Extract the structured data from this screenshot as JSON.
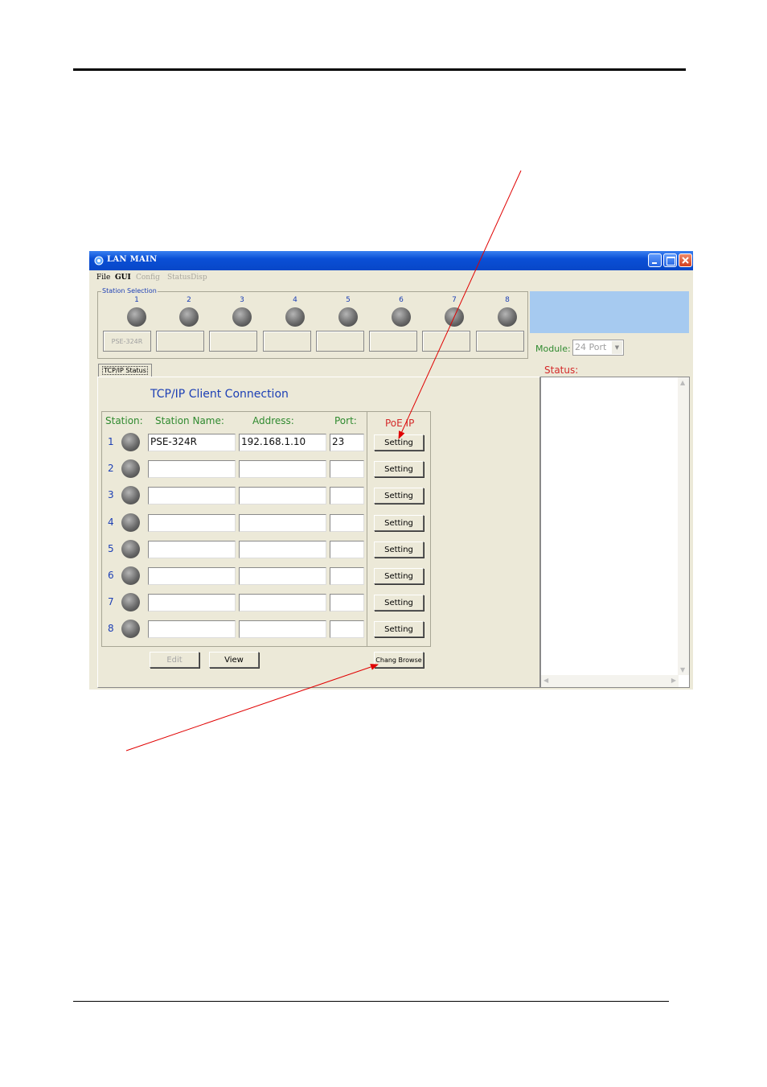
{
  "window": {
    "title": "LAN MAIN",
    "colors": {
      "titlebar": "#0a4fd6",
      "accent_blue_panel": "#a6caf0"
    }
  },
  "menu": [
    {
      "label": "File",
      "enabled": true
    },
    {
      "label": "GUI",
      "enabled": true
    },
    {
      "label": "Config",
      "enabled": false
    },
    {
      "label": "StatusDisp",
      "enabled": false
    }
  ],
  "station_selection": {
    "label": "Station Selection",
    "stations": [
      {
        "num": "1",
        "name": "PSE-324R"
      },
      {
        "num": "2",
        "name": ""
      },
      {
        "num": "3",
        "name": ""
      },
      {
        "num": "4",
        "name": ""
      },
      {
        "num": "5",
        "name": ""
      },
      {
        "num": "6",
        "name": ""
      },
      {
        "num": "7",
        "name": ""
      },
      {
        "num": "8",
        "name": ""
      }
    ]
  },
  "module": {
    "label": "Module:",
    "value": "24 Port"
  },
  "tab": {
    "label": "TCP/IP Status"
  },
  "connection": {
    "title": "TCP/IP Client Connection",
    "headers": {
      "station": "Station:",
      "name": "Station Name:",
      "address": "Address:",
      "port": "Port:",
      "poe": "PoE IP"
    },
    "setting_label": "Setting",
    "rows": [
      {
        "num": "1",
        "name": "PSE-324R",
        "address": "192.168.1.10",
        "port": "23"
      },
      {
        "num": "2",
        "name": "",
        "address": "",
        "port": ""
      },
      {
        "num": "3",
        "name": "",
        "address": "",
        "port": ""
      },
      {
        "num": "4",
        "name": "",
        "address": "",
        "port": ""
      },
      {
        "num": "5",
        "name": "",
        "address": "",
        "port": ""
      },
      {
        "num": "6",
        "name": "",
        "address": "",
        "port": ""
      },
      {
        "num": "7",
        "name": "",
        "address": "",
        "port": ""
      },
      {
        "num": "8",
        "name": "",
        "address": "",
        "port": ""
      }
    ],
    "buttons": {
      "edit": "Edit",
      "view": "View",
      "browse": "Chang Browse"
    }
  },
  "status": {
    "label": "Status:"
  }
}
